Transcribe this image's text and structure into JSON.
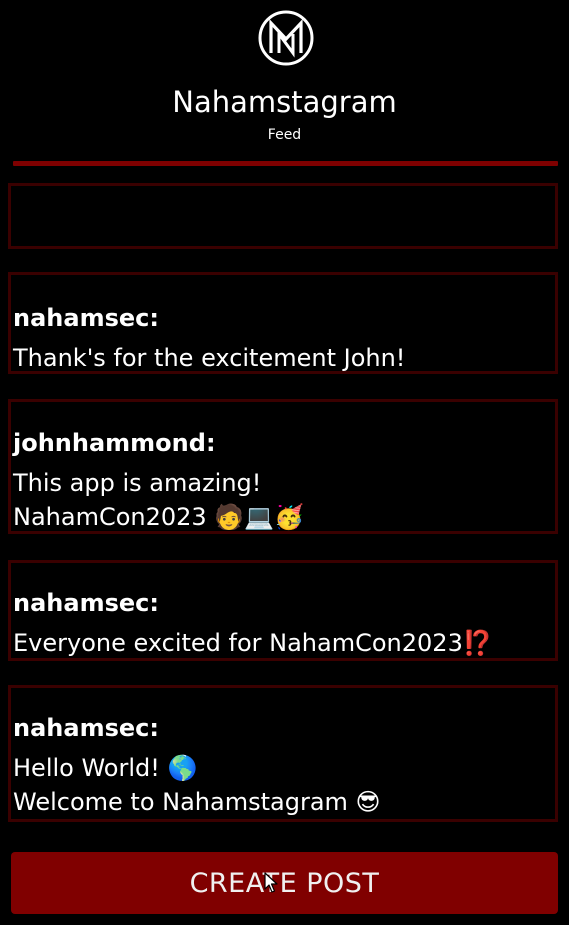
{
  "app": {
    "title": "Nahamstagram",
    "subtitle": "Feed",
    "logo_icon": "nahamsec-logo-icon"
  },
  "colors": {
    "background": "#000000",
    "accent": "#7e0000",
    "post_border": "#3a0000",
    "button": "#800000",
    "text": "#ffffff"
  },
  "feed": {
    "posts": [
      {
        "username": "",
        "text": ""
      },
      {
        "username": "nahamsec:",
        "text": "Thank's for the excitement John!"
      },
      {
        "username": "johnhammond:",
        "text": "This app is amazing!\nNahamCon2023 🧑💻🥳"
      },
      {
        "username": "nahamsec:",
        "text": "Everyone excited for NahamCon2023⁉️"
      },
      {
        "username": "nahamsec:",
        "text": "Hello World! 🌎\nWelcome to Nahamstagram 😎"
      }
    ]
  },
  "actions": {
    "create_post_label": "CREATE POST"
  }
}
